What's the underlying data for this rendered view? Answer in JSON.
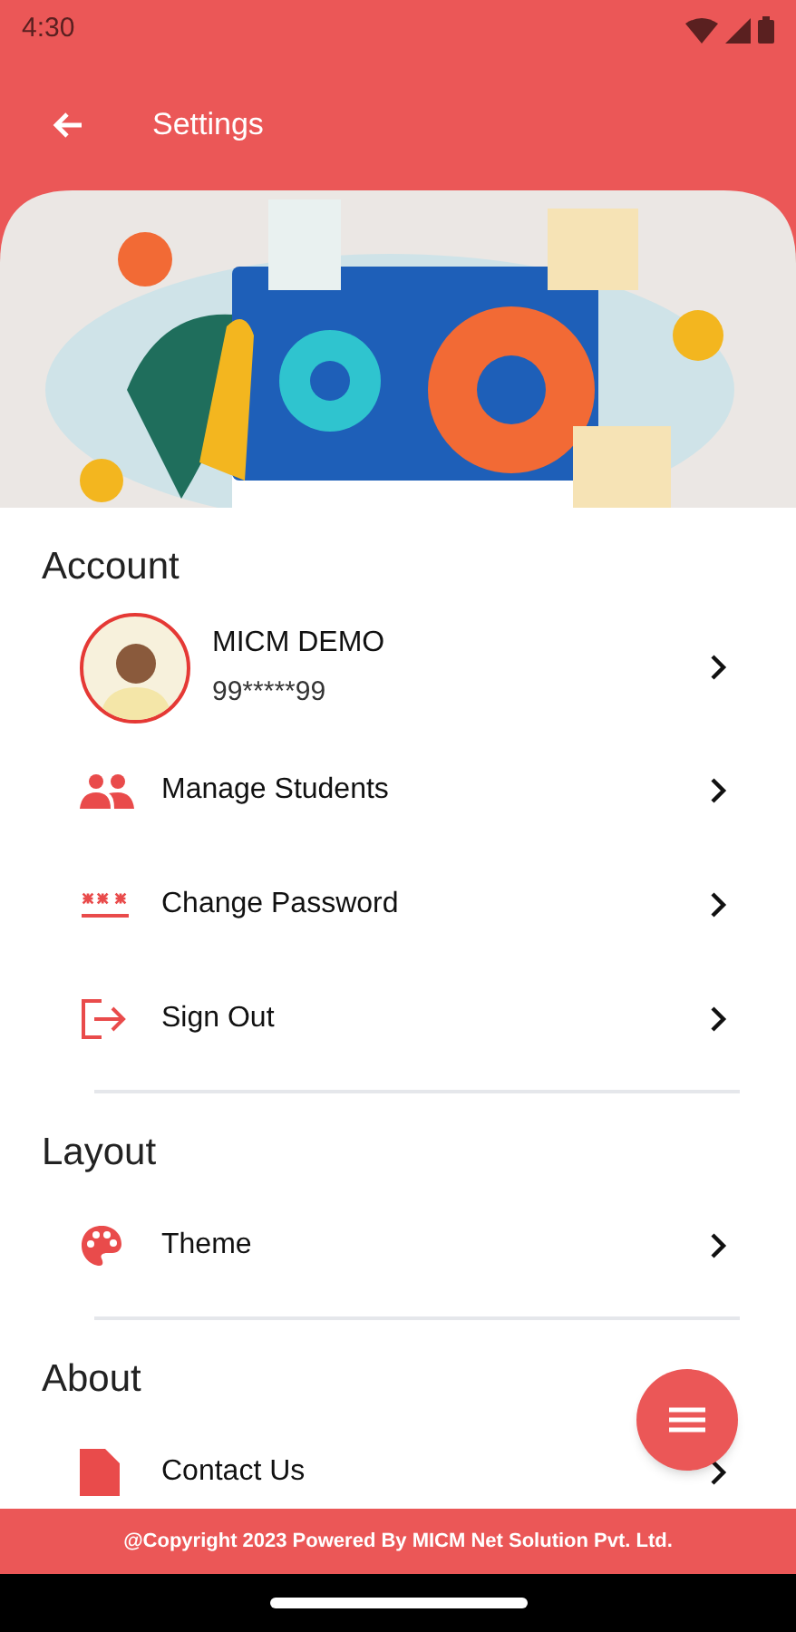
{
  "status_bar": {
    "time": "4:30"
  },
  "app_bar": {
    "title": "Settings"
  },
  "sections": [
    {
      "title": "Account",
      "items": [
        {
          "kind": "profile",
          "label": "MICM DEMO",
          "subtitle": "99*****99"
        },
        {
          "kind": "students",
          "label": "Manage Students"
        },
        {
          "kind": "password",
          "label": "Change Password"
        },
        {
          "kind": "signout",
          "label": "Sign Out"
        }
      ]
    },
    {
      "title": "Layout",
      "items": [
        {
          "kind": "theme",
          "label": "Theme"
        }
      ]
    },
    {
      "title": "About",
      "items": [
        {
          "kind": "contact",
          "label": "Contact Us"
        }
      ]
    }
  ],
  "footer": {
    "text": "@Copyright 2023 Powered By MICM Net Solution Pvt. Ltd."
  }
}
